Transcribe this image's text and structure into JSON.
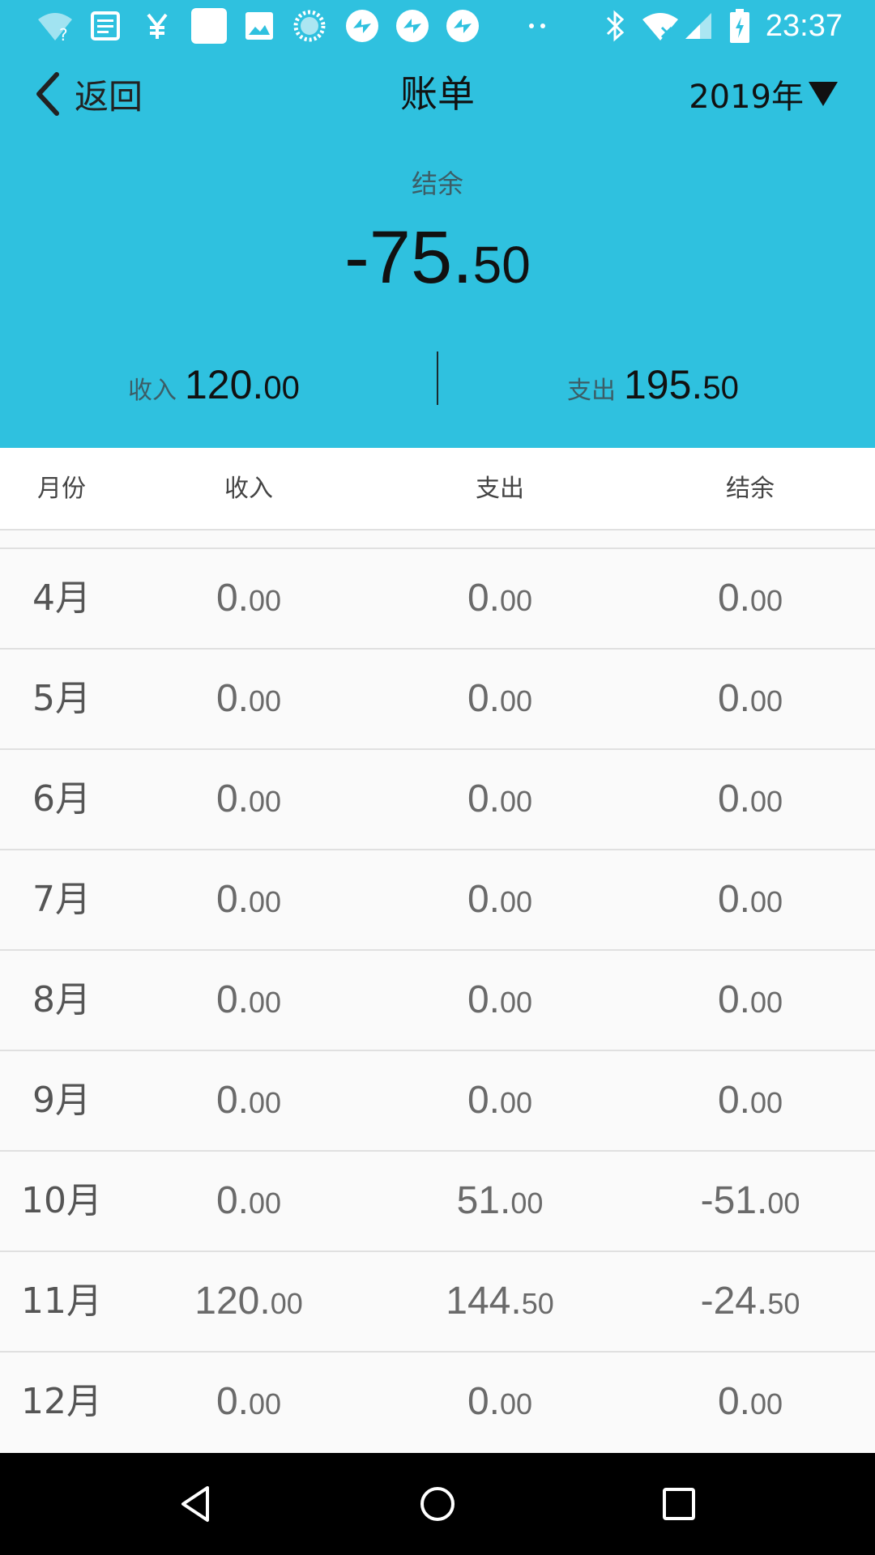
{
  "status_bar": {
    "time": "23:37",
    "icons": [
      "wifi-question-icon",
      "news-icon",
      "yuan-icon",
      "blank-app-icon",
      "image-icon",
      "loading-icon",
      "app-icon-1",
      "app-icon-2",
      "app-icon-3",
      "more-dots-icon",
      "bluetooth-icon",
      "wifi-off-icon",
      "signal-icon",
      "battery-charging-icon"
    ]
  },
  "app_bar": {
    "back_label": "返回",
    "title": "账单",
    "year": "2019年"
  },
  "summary": {
    "balance_label": "结余",
    "balance_int": "-75.",
    "balance_dec": "50",
    "income_label": "收入",
    "income_int": "120.",
    "income_dec": "00",
    "expense_label": "支出",
    "expense_int": "195.",
    "expense_dec": "50"
  },
  "table": {
    "headers": [
      "月份",
      "收入",
      "支出",
      "结余"
    ],
    "rows": [
      {
        "month": "4月",
        "income": [
          "0.",
          "00"
        ],
        "expense": [
          "0.",
          "00"
        ],
        "balance": [
          "0.",
          "00"
        ]
      },
      {
        "month": "5月",
        "income": [
          "0.",
          "00"
        ],
        "expense": [
          "0.",
          "00"
        ],
        "balance": [
          "0.",
          "00"
        ]
      },
      {
        "month": "6月",
        "income": [
          "0.",
          "00"
        ],
        "expense": [
          "0.",
          "00"
        ],
        "balance": [
          "0.",
          "00"
        ]
      },
      {
        "month": "7月",
        "income": [
          "0.",
          "00"
        ],
        "expense": [
          "0.",
          "00"
        ],
        "balance": [
          "0.",
          "00"
        ]
      },
      {
        "month": "8月",
        "income": [
          "0.",
          "00"
        ],
        "expense": [
          "0.",
          "00"
        ],
        "balance": [
          "0.",
          "00"
        ]
      },
      {
        "month": "9月",
        "income": [
          "0.",
          "00"
        ],
        "expense": [
          "0.",
          "00"
        ],
        "balance": [
          "0.",
          "00"
        ]
      },
      {
        "month": "10月",
        "income": [
          "0.",
          "00"
        ],
        "expense": [
          "51.",
          "00"
        ],
        "balance": [
          "-51.",
          "00"
        ]
      },
      {
        "month": "11月",
        "income": [
          "120.",
          "00"
        ],
        "expense": [
          "144.",
          "50"
        ],
        "balance": [
          "-24.",
          "50"
        ]
      },
      {
        "month": "12月",
        "income": [
          "0.",
          "00"
        ],
        "expense": [
          "0.",
          "00"
        ],
        "balance": [
          "0.",
          "00"
        ]
      }
    ]
  },
  "nav_bar": {
    "icons": [
      "nav-back-icon",
      "nav-home-icon",
      "nav-recents-icon"
    ]
  },
  "colors": {
    "header_bg": "#2fc1df",
    "list_bg": "#fafafa",
    "nav_bg": "#000000"
  }
}
